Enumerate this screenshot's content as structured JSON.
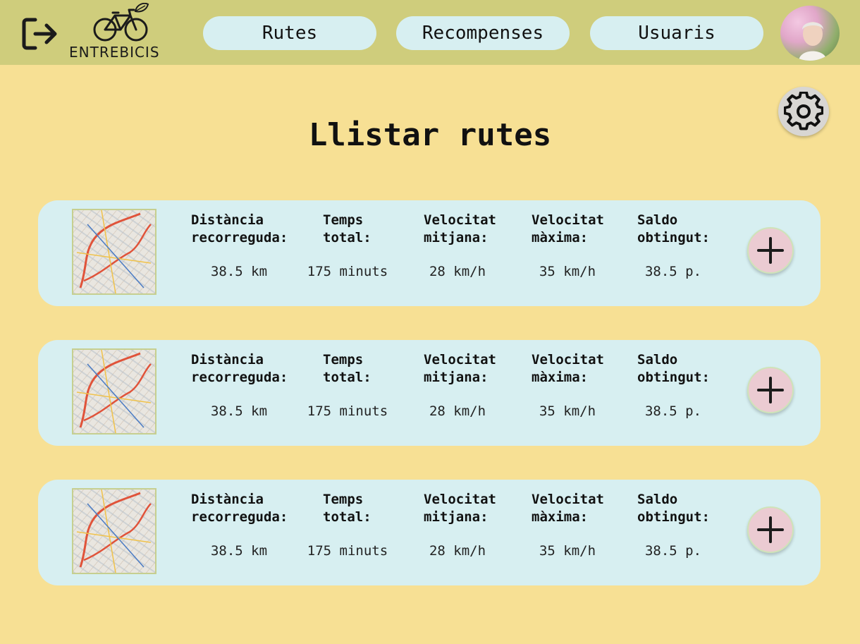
{
  "header": {
    "logo_text": "ENTREBICIS",
    "nav": [
      {
        "label": "Rutes"
      },
      {
        "label": "Recompenses"
      },
      {
        "label": "Usuaris"
      }
    ]
  },
  "page_title": "Llistar rutes",
  "stat_labels": {
    "distance": "Distància\nrecorreguda:",
    "time": "Temps\ntotal:",
    "avg_speed": "Velocitat\nmitjana:",
    "max_speed": "Velocitat\nmàxima:",
    "balance": "Saldo\nobtingut:"
  },
  "routes": [
    {
      "distance": "38.5 km",
      "time": "175 minuts",
      "avg_speed": "28 km/h",
      "max_speed": "35 km/h",
      "balance": "38.5 p."
    },
    {
      "distance": "38.5 km",
      "time": "175 minuts",
      "avg_speed": "28 km/h",
      "max_speed": "35 km/h",
      "balance": "38.5 p."
    },
    {
      "distance": "38.5 km",
      "time": "175 minuts",
      "avg_speed": "28 km/h",
      "max_speed": "35 km/h",
      "balance": "38.5 p."
    }
  ],
  "colors": {
    "background": "#f7e094",
    "header": "#cfcd7c",
    "card": "#d7eff1",
    "add_button": "#ebcbd2"
  },
  "icons": {
    "logout": "logout-icon",
    "settings": "gear-icon",
    "add": "plus-icon",
    "logo": "bicycle-leaf-icon"
  }
}
